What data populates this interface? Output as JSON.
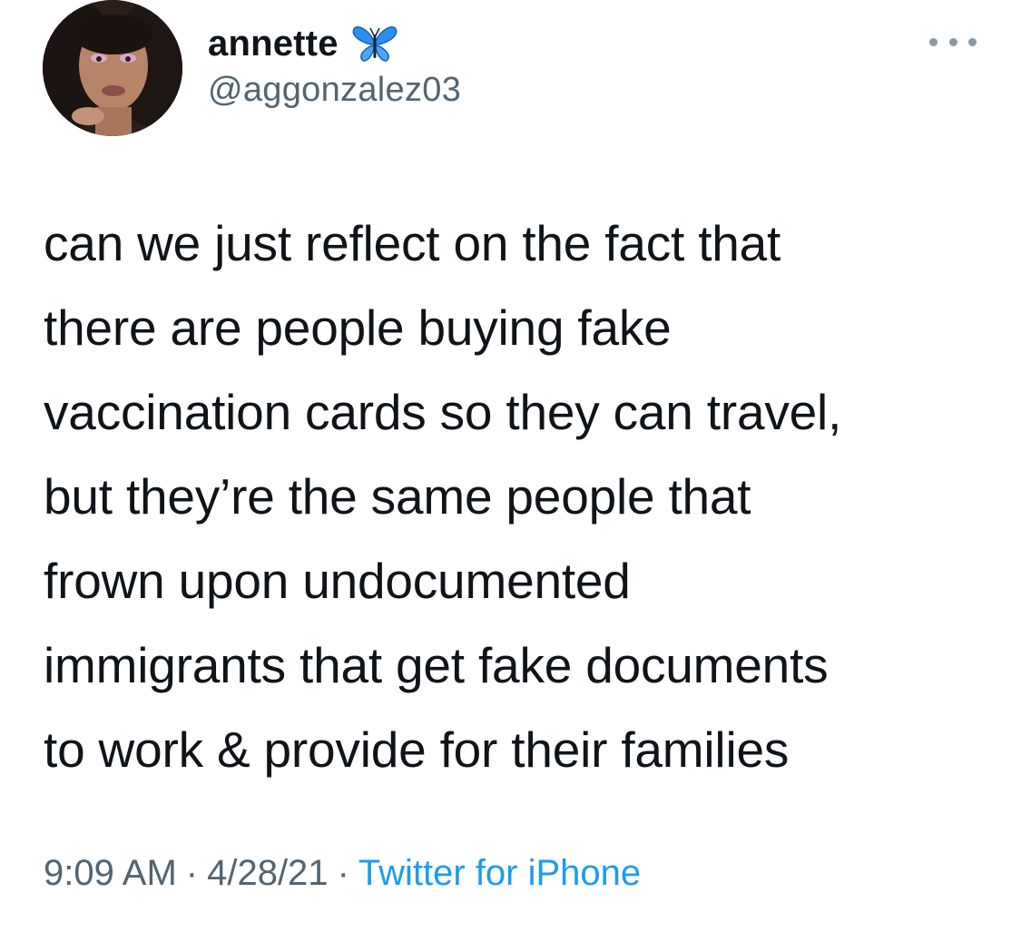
{
  "author": {
    "display_name": "annette",
    "handle": "@aggonzalez03",
    "badge_icon": "butterfly-icon",
    "avatar_icon": "profile-photo"
  },
  "tweet": {
    "lines": [
      "can we just reflect on the fact that",
      "there are people buying fake",
      "vaccination cards so they can travel,",
      "but they’re the same people that",
      "frown upon undocumented",
      "immigrants that get fake documents",
      "to work & provide for their families"
    ]
  },
  "meta": {
    "time": "9:09 AM",
    "date": "4/28/21",
    "separator": "·",
    "source": "Twitter for iPhone"
  },
  "colors": {
    "text": "#0f1419",
    "secondary": "#536471",
    "link": "#1d9bf0",
    "butterfly": "#2b8ff2"
  }
}
